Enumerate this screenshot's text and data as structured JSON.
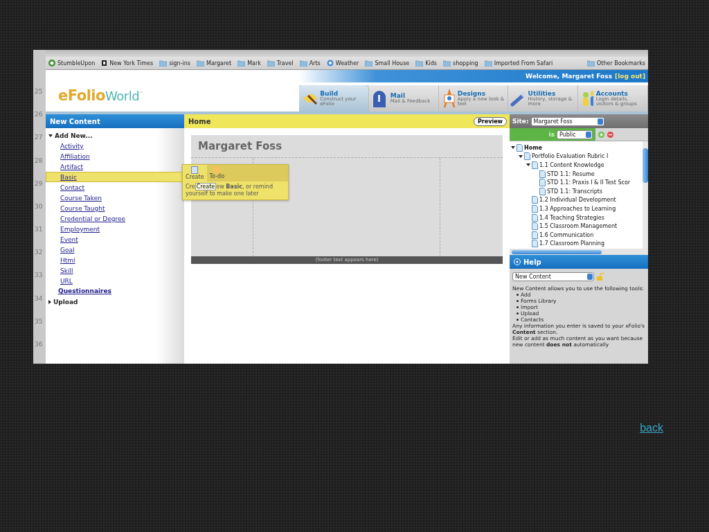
{
  "gutter": {
    "line_numbers": [
      "25",
      "26",
      "27",
      "28",
      "29",
      "30",
      "31",
      "32",
      "33",
      "34",
      "35",
      "36"
    ]
  },
  "bookmarks": [
    {
      "label": "StumbleUpon",
      "kind": "stumble"
    },
    {
      "label": "New York Times",
      "kind": "news"
    },
    {
      "label": "sign-ins",
      "kind": "folder"
    },
    {
      "label": "Margaret",
      "kind": "folder"
    },
    {
      "label": "Mark",
      "kind": "folder"
    },
    {
      "label": "Travel",
      "kind": "folder"
    },
    {
      "label": "Arts",
      "kind": "folder"
    },
    {
      "label": "Weather",
      "kind": "weather"
    },
    {
      "label": "Small House",
      "kind": "folder"
    },
    {
      "label": "Kids",
      "kind": "folder"
    },
    {
      "label": "shopping",
      "kind": "folder"
    },
    {
      "label": "Imported From Safari",
      "kind": "folder"
    }
  ],
  "other_bookmarks": "Other Bookmarks",
  "header": {
    "welcome": "Welcome, Margaret Foss",
    "logout": "[log out]",
    "logo": {
      "first": "eFolio",
      "second": "World",
      "mark": "™"
    },
    "nav": [
      {
        "title": "Build",
        "subtitle": "Construct your eFolio",
        "kind": "build",
        "selected": true
      },
      {
        "title": "Mail",
        "subtitle": "Mail & Feedback",
        "kind": "mail",
        "selected": false
      },
      {
        "title": "Designs",
        "subtitle": "Apply a new look & feel",
        "kind": "designs",
        "selected": false
      },
      {
        "title": "Utilities",
        "subtitle": "History, storage & more",
        "kind": "utilities",
        "selected": false
      },
      {
        "title": "Accounts",
        "subtitle": "Login details, visitors & groups",
        "kind": "accounts",
        "selected": false
      }
    ]
  },
  "left_panel": {
    "title": "New Content",
    "items": [
      {
        "kind": "group",
        "label": "Add New...",
        "expanded": true,
        "children": [
          {
            "label": "Activity",
            "selected": false
          },
          {
            "label": "Affiliation",
            "selected": false
          },
          {
            "label": "Artifact",
            "selected": false
          },
          {
            "label": "Basic",
            "selected": true
          },
          {
            "label": "Contact",
            "selected": false
          },
          {
            "label": "Course Taken",
            "selected": false
          },
          {
            "label": "Course Taught",
            "selected": false
          },
          {
            "label": "Credential or Degree",
            "selected": false
          },
          {
            "label": "Employment",
            "selected": false
          },
          {
            "label": "Event",
            "selected": false
          },
          {
            "label": "Goal",
            "selected": false
          },
          {
            "label": "Html",
            "selected": false
          },
          {
            "label": "Skill",
            "selected": false
          },
          {
            "label": "URL",
            "selected": false
          }
        ]
      },
      {
        "kind": "link",
        "label": "Questionnaires"
      },
      {
        "kind": "group",
        "label": "Upload",
        "expanded": false
      }
    ]
  },
  "popup": {
    "actions": [
      {
        "label": "Create",
        "kind": "create"
      },
      {
        "label": "To-do",
        "kind": "todo"
      }
    ],
    "text_start": "Cre",
    "tooltip": "Create",
    "text_rest": "ew **Basic**, or remind yourself to make one later"
  },
  "center": {
    "title": "Home",
    "preview": "Preview",
    "page_title": "Margaret Foss",
    "footer": "(footer text appears here)"
  },
  "right_panel": {
    "site_label": "Site:",
    "site": "Margaret Foss",
    "visibility_label": "is",
    "visibility": "Public",
    "tree": [
      {
        "label": "Home",
        "expanded": true,
        "children": [
          {
            "label": "Portfolio Evaluation Rubric I",
            "expanded": true,
            "children": [
              {
                "label": "1.1 Content Knowledge",
                "expanded": true,
                "children": [
                  {
                    "label": "STD 1.1: Resume"
                  },
                  {
                    "label": "STD 1.1: Praxis I & II Test Scor"
                  },
                  {
                    "label": "STD 1.1: Transcripts"
                  }
                ]
              },
              {
                "label": "1.2 Individual Development"
              },
              {
                "label": "1.3 Approaches to Learning"
              },
              {
                "label": "1.4 Teaching Strategies"
              },
              {
                "label": "1.5 Classroom Management"
              },
              {
                "label": "1.6 Communication"
              },
              {
                "label": "1.7 Classroom Planning"
              }
            ]
          }
        ]
      }
    ],
    "help_title": "Help",
    "help_topic": "New Content",
    "help_intro": "New Content allows you to use the following tools:",
    "help_list": [
      "Add",
      "Forms Library",
      "Import",
      "Upload",
      "Contacts"
    ],
    "help_notes": [
      "Any information you enter is saved to your xFolio's **Content** section.",
      "Edit or add as much content as you want because new content **does not** automatically"
    ]
  },
  "back_link": "back"
}
